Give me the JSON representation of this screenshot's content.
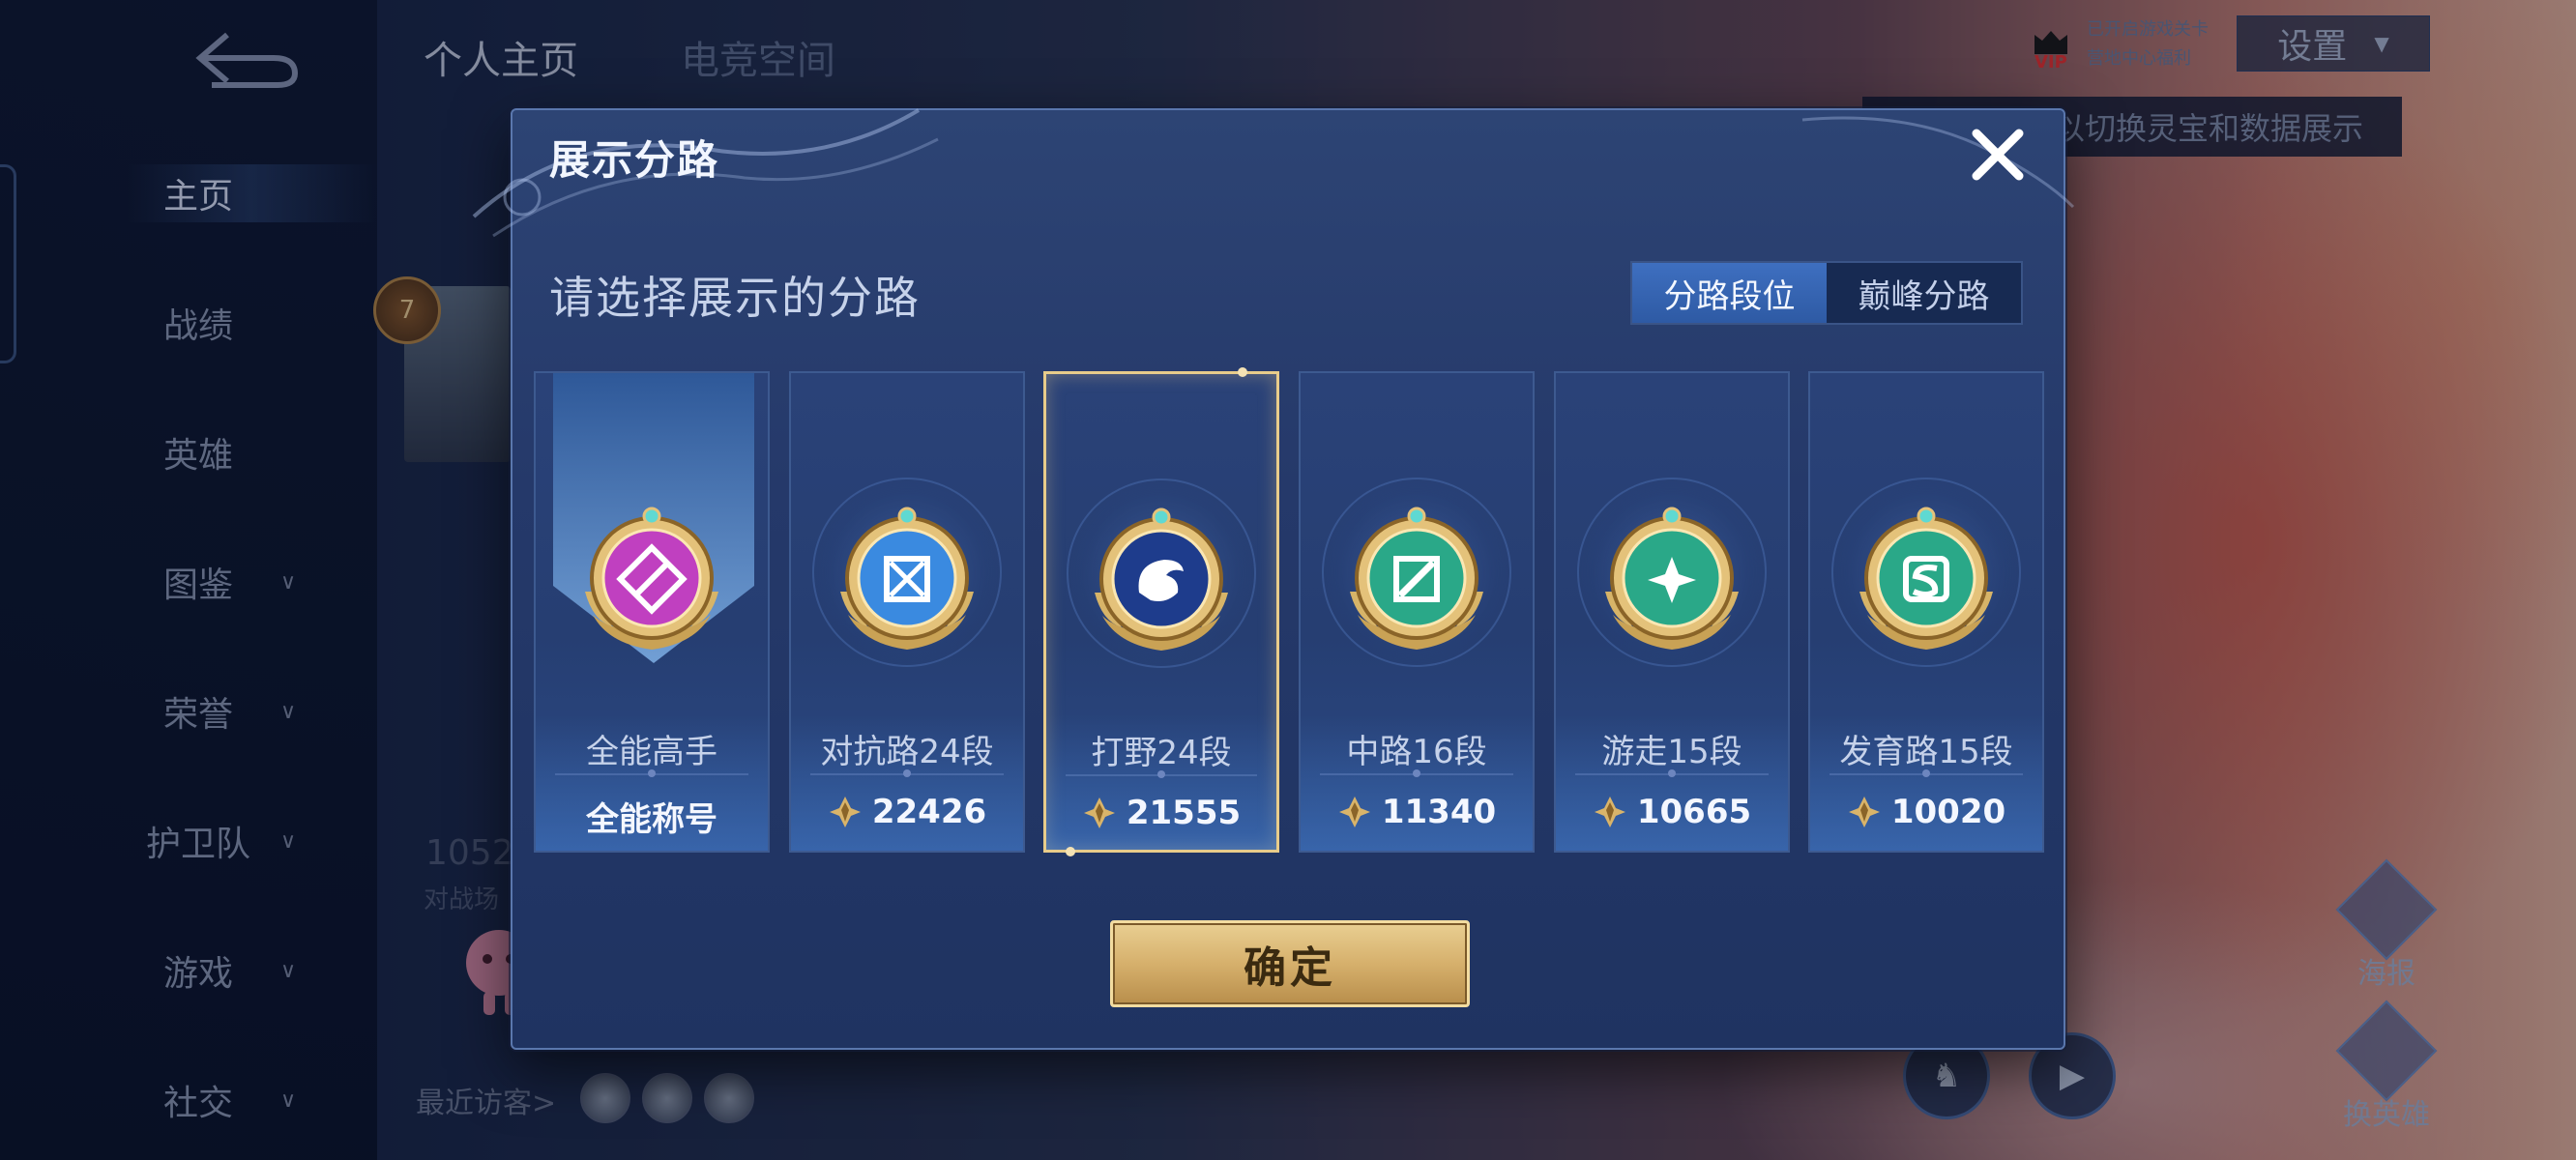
{
  "nav": {
    "items": [
      {
        "label": "主页",
        "has_chevron": false
      },
      {
        "label": "战绩",
        "has_chevron": false
      },
      {
        "label": "英雄",
        "has_chevron": false
      },
      {
        "label": "图鉴",
        "has_chevron": true
      },
      {
        "label": "荣誉",
        "has_chevron": true
      },
      {
        "label": "护卫队",
        "has_chevron": true
      },
      {
        "label": "游戏",
        "has_chevron": true
      },
      {
        "label": "社交",
        "has_chevron": true
      }
    ],
    "active_index": 0
  },
  "top_tabs": [
    {
      "label": "个人主页"
    },
    {
      "label": "电竞空间"
    }
  ],
  "header": {
    "vip_text": "VIP",
    "vip_line1": "已开启游戏关卡",
    "vip_line2": "营地中心福利",
    "settings_label": "设置",
    "tooltip": "以切换灵宝和数据展示"
  },
  "background": {
    "rank_number": "7",
    "stat_number": "1052",
    "stat_caption": "对战场",
    "recent_visitors": "最近访客>"
  },
  "right_floats": [
    {
      "label": "海报"
    },
    {
      "label": "换英雄"
    }
  ],
  "modal": {
    "title": "展示分路",
    "subtitle": "请选择展示的分路",
    "segments": [
      "分路段位",
      "巅峰分路"
    ],
    "active_segment": 0,
    "confirm_label": "确定",
    "cards": [
      {
        "label": "全能高手",
        "value": "全能称号",
        "emblem_color": "#c040c0",
        "icon": "all-rounder-icon",
        "selected": false,
        "has_points_icon": false
      },
      {
        "label": "对抗路24段",
        "value": "22426",
        "emblem_color": "#3a8ae0",
        "icon": "clash-lane-icon",
        "selected": false,
        "has_points_icon": true
      },
      {
        "label": "打野24段",
        "value": "21555",
        "emblem_color": "#1e3c8c",
        "icon": "jungle-icon",
        "selected": true,
        "has_points_icon": true
      },
      {
        "label": "中路16段",
        "value": "11340",
        "emblem_color": "#2aa888",
        "icon": "mid-lane-icon",
        "selected": false,
        "has_points_icon": true
      },
      {
        "label": "游走15段",
        "value": "10665",
        "emblem_color": "#2aa888",
        "icon": "roam-icon",
        "selected": false,
        "has_points_icon": true
      },
      {
        "label": "发育路15段",
        "value": "10020",
        "emblem_color": "#2aa888",
        "icon": "farm-lane-icon",
        "selected": false,
        "has_points_icon": true
      }
    ]
  }
}
